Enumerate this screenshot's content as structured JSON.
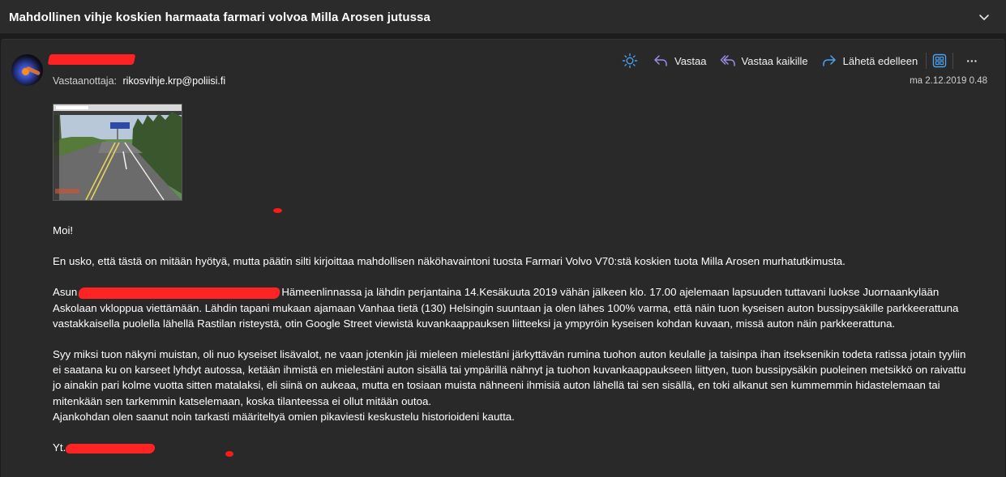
{
  "email": {
    "subject": "Mahdollinen vihje koskien harmaata farmari volvoa Milla Arosen jutussa",
    "recipient_label": "Vastaanottaja:",
    "recipient": "rikosvihje.krp@poliisi.fi",
    "date": "ma 2.12.2019 0.48"
  },
  "toolbar": {
    "reply_label": "Vastaa",
    "reply_all_label": "Vastaa kaikille",
    "forward_label": "Lähetä edelleen",
    "more_glyph": "···"
  },
  "body": {
    "greeting": "Moi!",
    "p1": "En usko, että tästä on mitään hyötyä, mutta päätin silti kirjoittaa mahdollisen näköhavaintoni tuosta Farmari Volvo V70:stä koskien tuota Milla Arosen murhatutkimusta.",
    "p2_start": "Asun",
    "p2_rest": "Hämeenlinnassa ja lähdin perjantaina 14.Kesäkuuta 2019 vähän jälkeen klo. 17.00 ajelemaan lapsuuden tuttavani luokse Juornaankylään Askolaan vkloppua viettämään. Lähdin tapani mukaan ajamaan Vanhaa tietä (130) Helsingin suuntaan ja olen lähes 100% varma, että näin tuon kyseisen auton bussipysäkille parkkeerattuna vastakkaisella puolella lähellä Rastilan risteystä, otin Google Street viewistä kuvankaappauksen liitteeksi ja ympyröin kyseisen kohdan kuvaan, missä auton näin parkkeerattuna.",
    "p3": "Syy miksi tuon näkyni muistan, oli nuo kyseiset lisävalot, ne vaan jotenkin jäi mieleen mielestäni järkyttävän rumina tuohon auton keulalle ja taisinpa ihan itseksenikin todeta ratissa jotain tyyliin ei saatana ku on karseet lyhdyt autossa, ketään ihmistä en mielestäni auton sisällä tai ympärillä nähnyt ja tuohon kuvankaappaukseen liittyen, tuon bussipysäkin puoleinen metsikkö on raivattu jo ainakin pari kolme vuotta sitten matalaksi, eli siinä on aukeaa, mutta en tosiaan muista nähneeni ihmisiä auton lähellä tai sen sisällä, en toki alkanut sen kummemmin hidastelemaan tai mitenkään sen tarkemmin katselemaan, koska tilanteessa ei ollut mitään outoa.",
    "p4": "Ajankohdan olen saanut noin tarkasti määriteltyä omien pikaviesti keskustelu historioideni kautta.",
    "signoff": "Yt."
  },
  "colors": {
    "background": "#1c1c1c",
    "card": "#292929",
    "subject_bar": "#2b2b2b",
    "redaction": "#ff2424",
    "icon_blue": "#4aa3f0",
    "icon_purple": "#9f8be8"
  },
  "icons": [
    "chevron-down-icon",
    "brightness-icon",
    "reply-icon",
    "reply-all-icon",
    "forward-icon",
    "immersive-reader-icon",
    "more-icon"
  ]
}
